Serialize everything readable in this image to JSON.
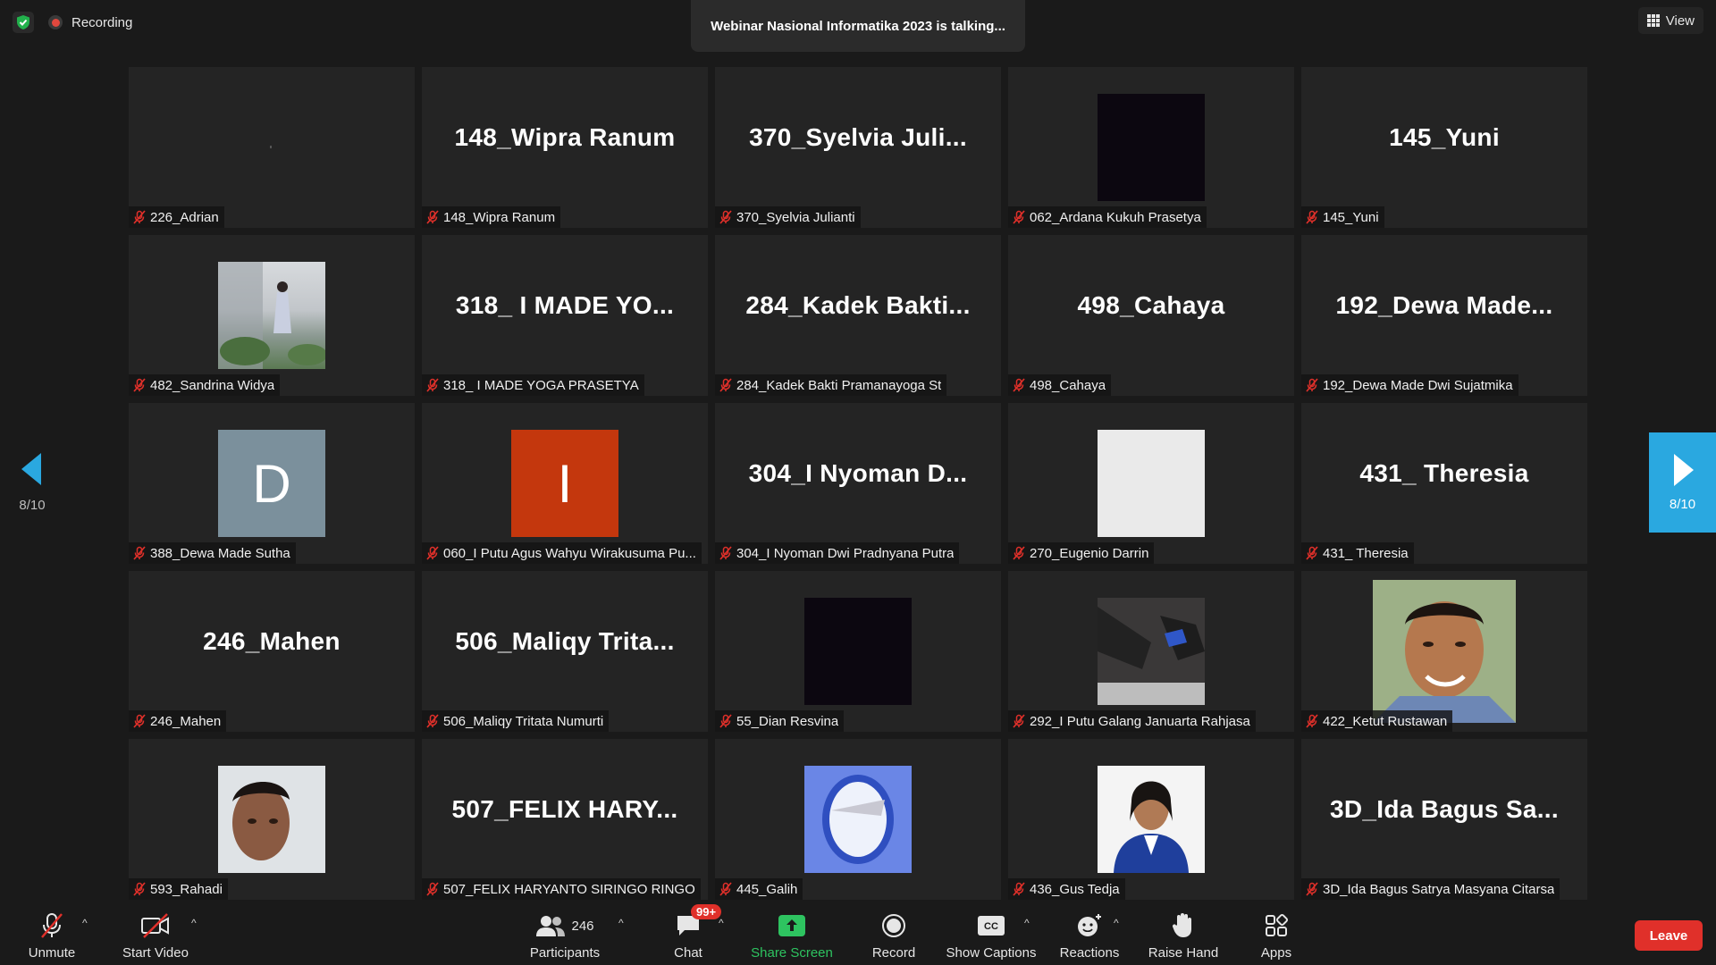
{
  "header": {
    "recording_label": "Recording",
    "talking_banner": "Webinar Nasional Informatika 2023 is talking...",
    "view_label": "View"
  },
  "pager": {
    "left_page": "8/10",
    "right_page": "8/10"
  },
  "tiles": [
    {
      "display": "",
      "name": "226_Adrian",
      "type": "blank"
    },
    {
      "display": "148_Wipra Ranum",
      "name": "148_Wipra Ranum",
      "type": "text"
    },
    {
      "display": "370_Syelvia  Juli...",
      "name": "370_Syelvia Julianti",
      "type": "text"
    },
    {
      "display": "",
      "name": "062_Ardana Kukuh Prasetya",
      "type": "dark-video"
    },
    {
      "display": "145_Yuni",
      "name": "145_Yuni",
      "type": "text"
    },
    {
      "display": "",
      "name": "482_Sandrina Widya",
      "type": "photo-outdoor"
    },
    {
      "display": "318_ I MADE YO...",
      "name": "318_ I MADE YOGA PRASETYA",
      "type": "text"
    },
    {
      "display": "284_Kadek  Bakti...",
      "name": "284_Kadek Bakti Pramanayoga St",
      "type": "text"
    },
    {
      "display": "498_Cahaya",
      "name": "498_Cahaya",
      "type": "text"
    },
    {
      "display": "192_Dewa  Made...",
      "name": "192_Dewa Made Dwi Sujatmika",
      "type": "text"
    },
    {
      "display": "D",
      "name": "388_Dewa Made Sutha",
      "type": "letter-gray"
    },
    {
      "display": "I",
      "name": "060_I Putu Agus Wahyu Wirakusuma Pu...",
      "type": "letter-orange"
    },
    {
      "display": "304_I  Nyoman  D...",
      "name": "304_I Nyoman Dwi Pradnyana Putra",
      "type": "text"
    },
    {
      "display": "",
      "name": "270_Eugenio Darrin",
      "type": "white-video"
    },
    {
      "display": "431_ Theresia",
      "name": "431_ Theresia",
      "type": "text"
    },
    {
      "display": "246_Mahen",
      "name": "246_Mahen",
      "type": "text"
    },
    {
      "display": "506_Maliqy  Trita...",
      "name": "506_Maliqy Tritata Numurti",
      "type": "text"
    },
    {
      "display": "",
      "name": "55_Dian Resvina",
      "type": "dark-video"
    },
    {
      "display": "",
      "name": "292_I Putu Galang Januarta Rahjasa",
      "type": "photo-feet"
    },
    {
      "display": "",
      "name": "422_Ketut Rustawan",
      "type": "photo-face-large"
    },
    {
      "display": "",
      "name": "593_Rahadi",
      "type": "photo-selfie"
    },
    {
      "display": "507_FELIX  HARY...",
      "name": "507_FELIX HARYANTO SIRINGO RINGO",
      "type": "text"
    },
    {
      "display": "",
      "name": "445_Galih",
      "type": "photo-window"
    },
    {
      "display": "",
      "name": "436_Gus Tedja",
      "type": "photo-portrait"
    },
    {
      "display": "3D_Ida  Bagus  Sa...",
      "name": "3D_Ida Bagus Satrya Masyana Citarsa",
      "type": "text"
    }
  ],
  "toolbar": {
    "unmute": "Unmute",
    "start_video": "Start Video",
    "participants": "Participants",
    "participants_count": "246",
    "chat": "Chat",
    "chat_badge": "99+",
    "share_screen": "Share Screen",
    "record": "Record",
    "show_captions": "Show Captions",
    "captions_icon_text": "CC",
    "reactions": "Reactions",
    "raise_hand": "Raise Hand",
    "apps": "Apps",
    "leave": "Leave"
  },
  "colors": {
    "accent_blue": "#2aa8e0",
    "leave_red": "#e0302a",
    "share_green": "#2ec360",
    "orange_avatar": "#c4370d",
    "gray_avatar": "#7b909c"
  }
}
